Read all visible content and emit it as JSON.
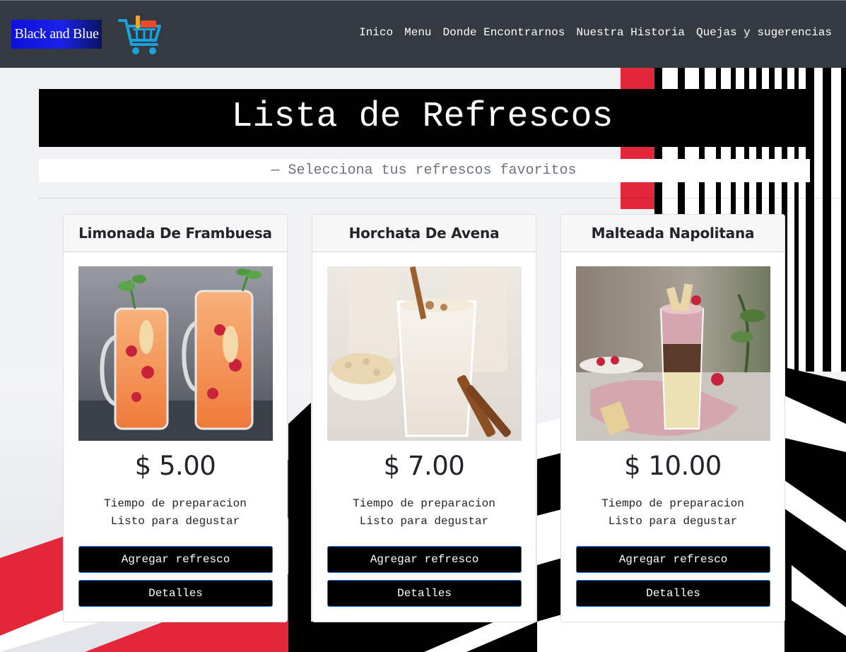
{
  "navbar": {
    "brand": "Black and Blue",
    "cart_icon": "shopping-cart-icon",
    "links": [
      "Inico",
      "Menu",
      "Donde Encontrarnos",
      "Nuestra Historia",
      "Quejas y sugerencias"
    ]
  },
  "header": {
    "title": "Lista de Refrescos",
    "subtitle": "— Selecciona tus refrescos favoritos"
  },
  "products": [
    {
      "name": "Limonada De Frambuesa",
      "price": "$ 5.00",
      "prep_label": "Tiempo de preparacion",
      "status": "Listo para degustar",
      "add_label": "Agregar refresco",
      "details_label": "Detalles"
    },
    {
      "name": "Horchata De Avena",
      "price": "$ 7.00",
      "prep_label": "Tiempo de preparacion",
      "status": "Listo para degustar",
      "add_label": "Agregar refresco",
      "details_label": "Detalles"
    },
    {
      "name": "Malteada Napolitana",
      "price": "$ 10.00",
      "prep_label": "Tiempo de preparacion",
      "status": "Listo para degustar",
      "add_label": "Agregar refresco",
      "details_label": "Detalles"
    }
  ],
  "colors": {
    "navbar": "#343a40",
    "brand_bg": "#1b22e8",
    "accent_red": "#e3263a",
    "button_bg": "#000000",
    "button_border": "#0d6efd"
  }
}
